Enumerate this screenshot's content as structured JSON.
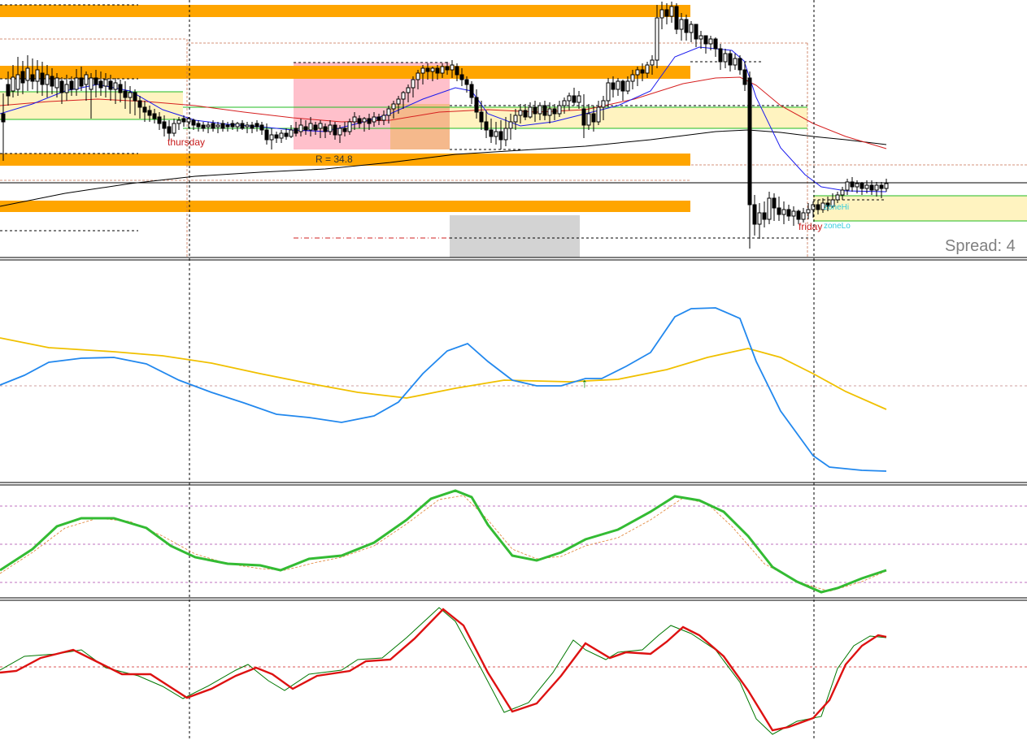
{
  "chart_data": {
    "type": "line",
    "labels": {
      "thursday": "thursday",
      "friday": "friday",
      "range": "R = 34.8",
      "spread": "Spread: 4",
      "zone_hi": "zoneHi",
      "zone_lo": "zoneLo"
    },
    "colors": {
      "orange_zone": "#ffa500",
      "pink_box": "#ffc0cb",
      "yellow_zone": "#fff3c0",
      "grey_box": "#d3d3d3",
      "green_line": "#22bb22",
      "blue_ma": "#1a1aee",
      "red_ma": "#d62020",
      "black_ma": "#000000",
      "indicator_blue": "#2288ee",
      "indicator_gold": "#f0c000",
      "stoch_green": "#33bb33",
      "macd_red": "#dd1111",
      "macd_green": "#007700",
      "arrow_green": "#008000"
    },
    "candles": [],
    "panels": [
      {
        "name": "price",
        "series": [
          "candles",
          "ma-blue",
          "ma-red",
          "ma-black"
        ]
      },
      {
        "name": "oscillator-1",
        "series": [
          "blue",
          "gold"
        ]
      },
      {
        "name": "oscillator-2",
        "series": [
          "green",
          "orange-signal"
        ]
      },
      {
        "name": "oscillator-3",
        "series": [
          "red",
          "green-signal"
        ]
      }
    ]
  }
}
